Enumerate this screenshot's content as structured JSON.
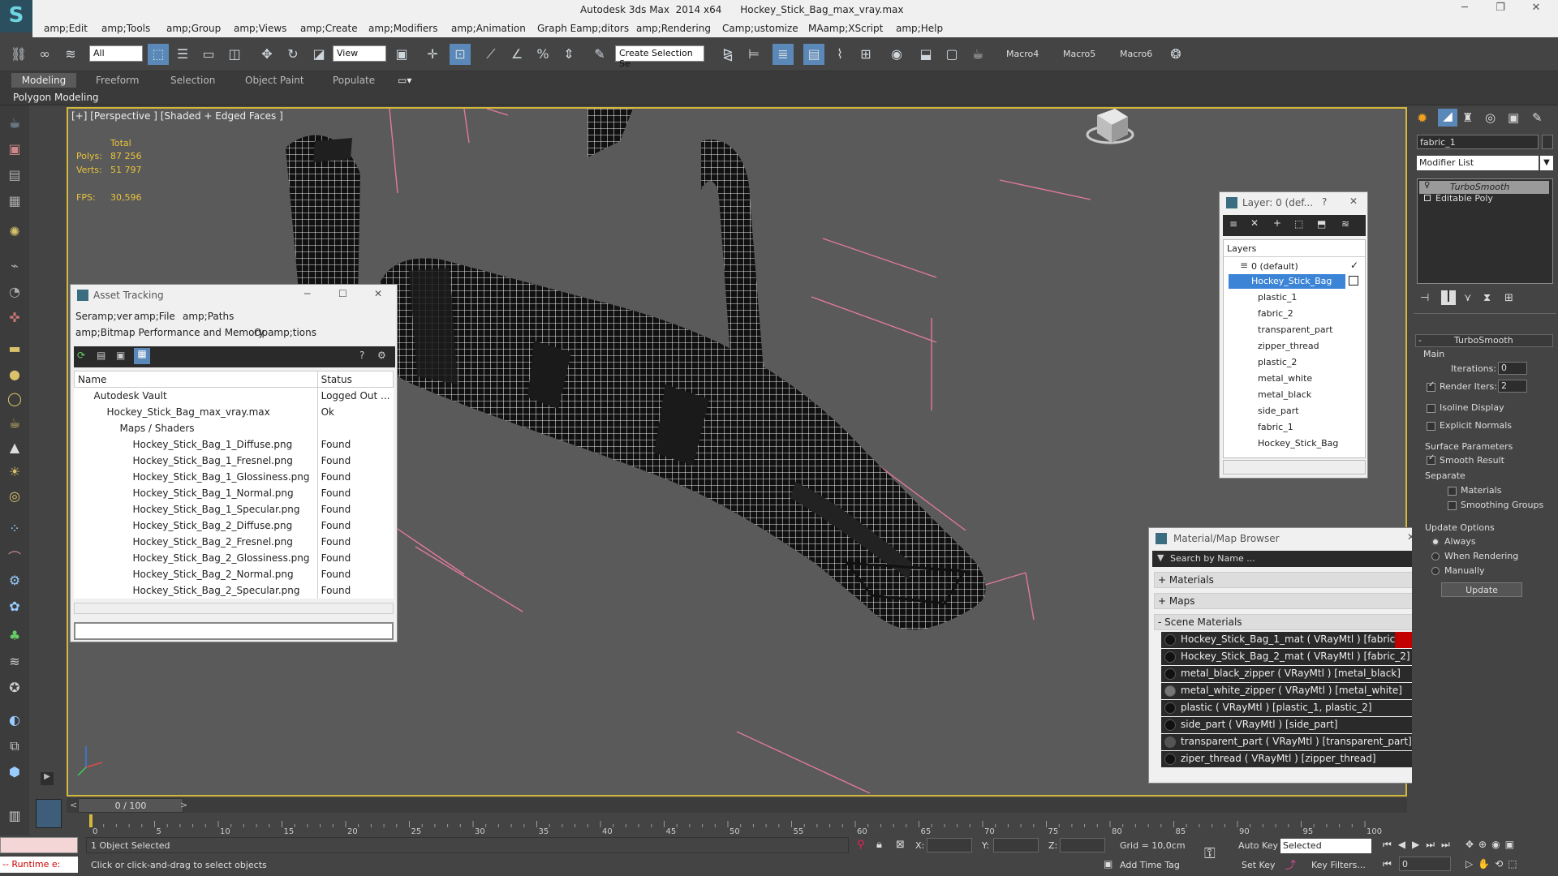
{
  "titlebar": {
    "app": "Autodesk 3ds Max  2014 x64",
    "file": "Hockey_Stick_Bag_max_vray.max"
  },
  "menu": [
    "amp;Edit",
    "amp;Tools",
    "amp;Group",
    "amp;Views",
    "amp;Create",
    "amp;Modifiers",
    "amp;Animation",
    "Graph Eamp;ditors",
    "amp;Rendering",
    "Camp;ustomize",
    "MAamp;XScript",
    "amp;Help"
  ],
  "toolbar": {
    "filter": "All",
    "refcoord": "View",
    "selset": "Create Selection Se",
    "macros": [
      "Macro4",
      "Macro5",
      "Macro6"
    ]
  },
  "ribbon": {
    "tabs": [
      "Modeling",
      "Freeform",
      "Selection",
      "Object Paint",
      "Populate"
    ],
    "sub": "Polygon Modeling"
  },
  "viewport": {
    "label": "[+] [Perspective ] [Shaded + Edged Faces ]",
    "stats": {
      "total": "Total",
      "polys_label": "Polys:",
      "polys": "87 256",
      "verts_label": "Verts:",
      "verts": "51 797",
      "fps_label": "FPS:",
      "fps": "30,596"
    }
  },
  "asset": {
    "title": "Asset Tracking",
    "menu1": [
      "Seramp;ver",
      "amp;File",
      "amp;Paths"
    ],
    "menu2": [
      "amp;Bitmap Performance and Memory",
      "Opamp;tions"
    ],
    "col_name": "Name",
    "col_status": "Status",
    "rows": [
      {
        "name": "Autodesk Vault",
        "status": "Logged Out ..."
      },
      {
        "name": "Hockey_Stick_Bag_max_vray.max",
        "status": "Ok"
      },
      {
        "name": "Maps / Shaders",
        "status": ""
      },
      {
        "name": "Hockey_Stick_Bag_1_Diffuse.png",
        "status": "Found"
      },
      {
        "name": "Hockey_Stick_Bag_1_Fresnel.png",
        "status": "Found"
      },
      {
        "name": "Hockey_Stick_Bag_1_Glossiness.png",
        "status": "Found"
      },
      {
        "name": "Hockey_Stick_Bag_1_Normal.png",
        "status": "Found"
      },
      {
        "name": "Hockey_Stick_Bag_1_Specular.png",
        "status": "Found"
      },
      {
        "name": "Hockey_Stick_Bag_2_Diffuse.png",
        "status": "Found"
      },
      {
        "name": "Hockey_Stick_Bag_2_Fresnel.png",
        "status": "Found"
      },
      {
        "name": "Hockey_Stick_Bag_2_Glossiness.png",
        "status": "Found"
      },
      {
        "name": "Hockey_Stick_Bag_2_Normal.png",
        "status": "Found"
      },
      {
        "name": "Hockey_Stick_Bag_2_Specular.png",
        "status": "Found"
      }
    ]
  },
  "layer": {
    "title": "Layer: 0 (def...",
    "header": "Layers",
    "items": [
      "0 (default)",
      "Hockey_Stick_Bag",
      "plastic_1",
      "fabric_2",
      "transparent_part",
      "zipper_thread",
      "plastic_2",
      "metal_white",
      "metal_black",
      "side_part",
      "fabric_1",
      "Hockey_Stick_Bag"
    ]
  },
  "matbrowser": {
    "title": "Material/Map Browser",
    "search": "Search by Name ...",
    "sections": [
      "+ Materials",
      "+ Maps",
      "- Scene Materials"
    ],
    "materials": [
      "Hockey_Stick_Bag_1_mat ( VRayMtl ) [fabric_1]",
      "Hockey_Stick_Bag_2_mat ( VRayMtl ) [fabric_2]",
      "metal_black_zipper ( VRayMtl ) [metal_black]",
      "metal_white_zipper ( VRayMtl ) [metal_white]",
      "plastic ( VRayMtl ) [plastic_1, plastic_2]",
      "side_part ( VRayMtl ) [side_part]",
      "transparent_part ( VRayMtl ) [transparent_part]",
      "ziper_thread ( VRayMtl ) [zipper_thread]"
    ]
  },
  "cmd": {
    "object_name": "fabric_1",
    "modifier_list": "Modifier List",
    "stack": [
      "TurboSmooth",
      "Editable Poly"
    ],
    "rollout": "TurboSmooth",
    "main": "Main",
    "iterations_label": "Iterations:",
    "iterations": "0",
    "render_iters_label": "Render Iters:",
    "render_iters": "2",
    "isoline": "Isoline Display",
    "explicit": "Explicit Normals",
    "surface": "Surface Parameters",
    "smooth": "Smooth Result",
    "separate": "Separate",
    "materials": "Materials",
    "smoothing": "Smoothing Groups",
    "update_opts": "Update Options",
    "always": "Always",
    "when_rendering": "When Rendering",
    "manually": "Manually",
    "update_btn": "Update"
  },
  "timeline": {
    "frame": "0 / 100",
    "ticks": [
      "0",
      "5",
      "10",
      "15",
      "20",
      "25",
      "30",
      "35",
      "40",
      "45",
      "50",
      "55",
      "60",
      "65",
      "70",
      "75",
      "80",
      "85",
      "90",
      "95",
      "100"
    ]
  },
  "status": {
    "runtime": "-- Runtime e:",
    "selected": "1 Object Selected",
    "prompt": "Click or click-and-drag to select objects",
    "x": "X:",
    "y": "Y:",
    "z": "Z:",
    "grid": "Grid = 10,0cm",
    "add_time_tag": "Add Time Tag",
    "auto_key": "Auto Key",
    "set_key": "Set Key",
    "selected_dd": "Selected",
    "key_filters": "Key Filters...",
    "frame_field": "0"
  }
}
